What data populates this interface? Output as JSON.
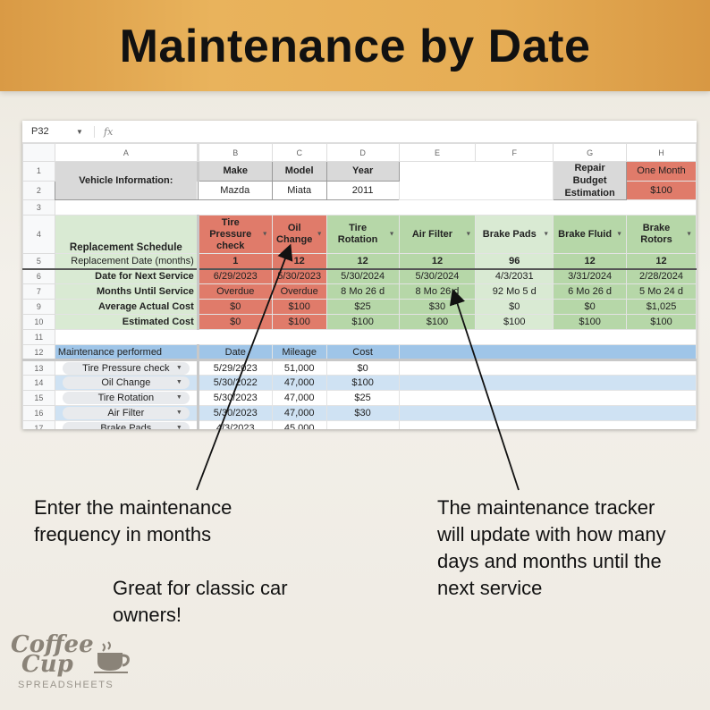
{
  "banner": {
    "title": "Maintenance by Date"
  },
  "formula_bar": {
    "cell_ref": "P32",
    "fx": "fx"
  },
  "columns": [
    "A",
    "B",
    "C",
    "D",
    "E",
    "F",
    "G",
    "H"
  ],
  "row_numbers": [
    "1",
    "2",
    "3",
    "4",
    "5",
    "6",
    "7",
    "9",
    "10",
    "11",
    "12",
    "13",
    "14",
    "15",
    "16",
    "17"
  ],
  "vehicle": {
    "label": "Vehicle Information:",
    "headers": [
      "Make",
      "Model",
      "Year"
    ],
    "values": [
      "Mazda",
      "Miata",
      "2011"
    ]
  },
  "budget": {
    "label": "Repair Budget Estimation",
    "period": "One Month",
    "amount": "$100"
  },
  "schedule": {
    "title": "Replacement Schedule",
    "freq_label": "Replacement Date (months)",
    "row_labels": [
      "Date for Next Service",
      "Months Until Service",
      "Average Actual Cost",
      "Estimated Cost"
    ],
    "items": [
      {
        "name": "Tire Pressure check",
        "months": "1",
        "next": "6/29/2023",
        "until": "Overdue",
        "avg": "$0",
        "est": "$0",
        "status": "overdue"
      },
      {
        "name": "Oil Change",
        "months": "12",
        "next": "5/30/2023",
        "until": "Overdue",
        "avg": "$100",
        "est": "$100",
        "status": "overdue"
      },
      {
        "name": "Tire Rotation",
        "months": "12",
        "next": "5/30/2024",
        "until": "8 Mo 26 d",
        "avg": "$25",
        "est": "$100",
        "status": "ok"
      },
      {
        "name": "Air Filter",
        "months": "12",
        "next": "5/30/2024",
        "until": "8 Mo 26 d",
        "avg": "$30",
        "est": "$100",
        "status": "ok"
      },
      {
        "name": "Brake Pads",
        "months": "96",
        "next": "4/3/2031",
        "until": "92 Mo 5 d",
        "avg": "$0",
        "est": "$100",
        "status": "ok-light"
      },
      {
        "name": "Brake Fluid",
        "months": "12",
        "next": "3/31/2024",
        "until": "6 Mo 26 d",
        "avg": "$0",
        "est": "$100",
        "status": "ok"
      },
      {
        "name": "Brake Rotors",
        "months": "12",
        "next": "2/28/2024",
        "until": "5 Mo 24 d",
        "avg": "$1,025",
        "est": "$100",
        "status": "ok"
      }
    ]
  },
  "log": {
    "headers": [
      "Maintenance performed",
      "Date",
      "Mileage",
      "Cost"
    ],
    "rows": [
      [
        "Tire Pressure check",
        "5/29/2023",
        "51,000",
        "$0"
      ],
      [
        "Oil Change",
        "5/30/2022",
        "47,000",
        "$100"
      ],
      [
        "Tire Rotation",
        "5/30/2023",
        "47,000",
        "$25"
      ],
      [
        "Air Filter",
        "5/30/2023",
        "47,000",
        "$30"
      ],
      [
        "Brake Pads",
        "4/3/2023",
        "45,000",
        ""
      ]
    ]
  },
  "notes": {
    "left": "Enter the maintenance frequency in months",
    "middle": "Great for classic car owners!",
    "right": "The maintenance tracker will update with how many days and months until the next service"
  },
  "logo": {
    "line1": "Coffee",
    "line2": "Cup",
    "tagline": "SPREADSHEETS"
  },
  "colors": {
    "overdue": "#e07b6a",
    "ok": "#b6d7a8",
    "light_green": "#d9ead3",
    "header_blue": "#9fc5e8",
    "row_blue": "#cfe2f3",
    "banner": "#e6ad55"
  }
}
